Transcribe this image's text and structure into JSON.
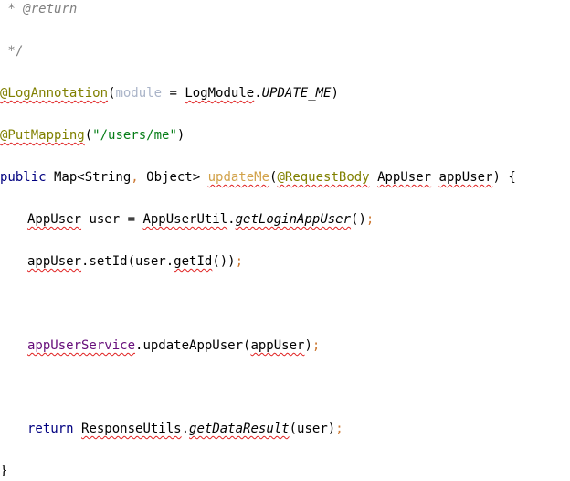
{
  "code": {
    "line1": {
      "star": " * ",
      "tag": "@return"
    },
    "line2": {
      "text": " */"
    },
    "line3": {
      "annotation": "@LogAnnotation",
      "open": "(",
      "param": "module",
      "eq": " = ",
      "cls": "LogModule",
      "dot": ".",
      "const": "UPDATE_ME",
      "close": ")"
    },
    "line4": {
      "annotation": "@PutMapping",
      "open": "(",
      "str": "\"/users/me\"",
      "close": ")"
    },
    "line5": {
      "kw": "public",
      "ret": " Map<String",
      "comma": ",",
      "ret2": " Object> ",
      "method": "updateMe",
      "open": "(",
      "annotation": "@RequestBody",
      "sp": " ",
      "type": "AppUser",
      "sp2": " ",
      "arg": "appUser",
      "close": ") {"
    },
    "line6": {
      "type": "AppUser",
      "mid": " user = ",
      "cls": "AppUserUtil",
      "dot": ".",
      "call": "getLoginAppUser",
      "paren": "()",
      "semi": ";"
    },
    "line7": {
      "obj": "appUser",
      "mid": ".setId(user.",
      "get": "getId",
      "end": "())",
      "semi": ";"
    },
    "line8": {
      "field": "appUserService",
      "mid": ".updateAppUser(",
      "arg": "appUser",
      "close": ")",
      "semi": ";"
    },
    "line9": {
      "kw": "return",
      "sp": " ",
      "cls": "ResponseUtils",
      "dot": ".",
      "call": "getDataResult",
      "args": "(user)",
      "semi": ";"
    },
    "line10": {
      "text": "}"
    }
  }
}
